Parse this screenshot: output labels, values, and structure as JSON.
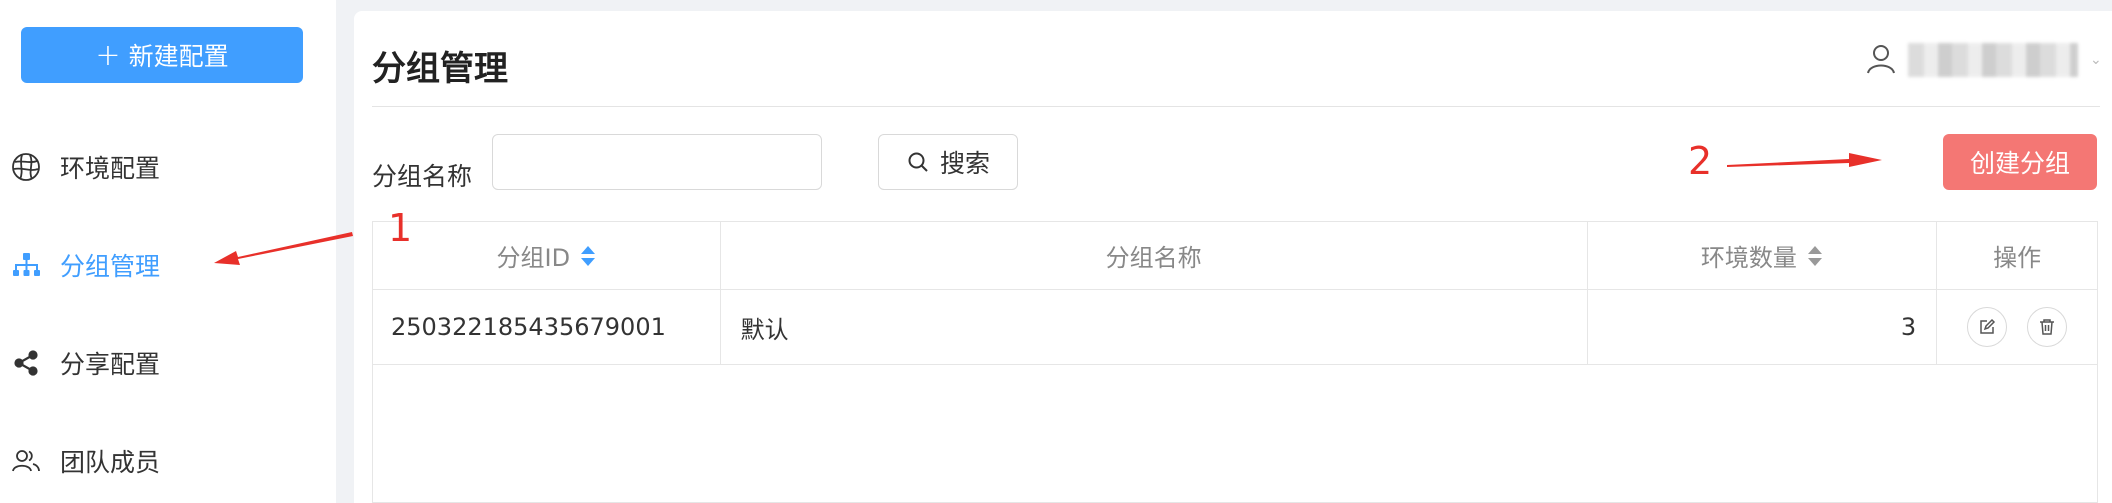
{
  "sidebar": {
    "new_button": {
      "icon": "plus-icon",
      "label": "新建配置"
    },
    "items": [
      {
        "label": "环境配置",
        "icon": "globe-icon",
        "active": false
      },
      {
        "label": "分组管理",
        "icon": "org-tree-icon",
        "active": true
      },
      {
        "label": "分享配置",
        "icon": "share-icon",
        "active": false
      },
      {
        "label": "团队成员",
        "icon": "team-icon",
        "active": false
      }
    ]
  },
  "header": {
    "title": "分组管理",
    "user_icon": "user-icon"
  },
  "search": {
    "label": "分组名称",
    "input_value": "",
    "button_label": "搜索",
    "button_icon": "search-icon"
  },
  "actions": {
    "create_label": "创建分组"
  },
  "table": {
    "columns": [
      "分组ID",
      "分组名称",
      "环境数量",
      "操作"
    ],
    "rows": [
      {
        "id": "250322185435679001",
        "name": "默认",
        "env_count": "3"
      }
    ]
  },
  "annotations": {
    "marker_1": "1",
    "marker_2": "2"
  },
  "colors": {
    "primary": "#409eff",
    "create_button": "#f47774",
    "annotation": "#e8302a"
  }
}
